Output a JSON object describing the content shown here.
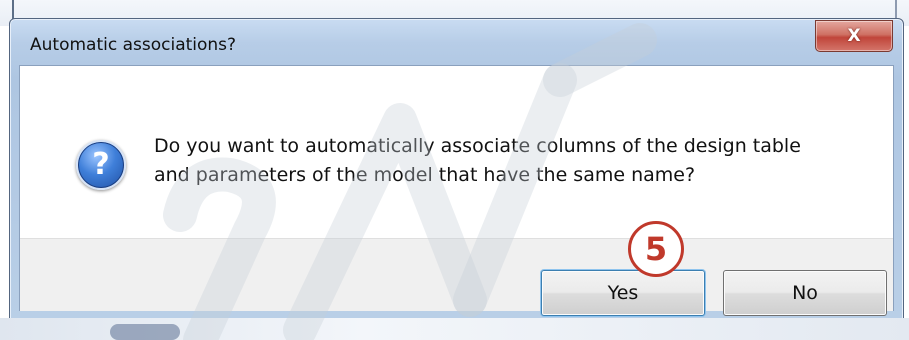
{
  "dialog": {
    "title": "Automatic associations?",
    "close_label": "X",
    "icon": "question-icon",
    "message_lines": [
      "Do you want to automatically associate columns of the design table",
      "and parameters of the model that have the same name?"
    ],
    "buttons": {
      "yes": "Yes",
      "no": "No"
    }
  },
  "annotation": {
    "step": "5",
    "color": "#c0392b"
  },
  "colors": {
    "titlebar": "#b7cde7",
    "close_button": "#c0453a",
    "footer": "#f0f0f0"
  }
}
